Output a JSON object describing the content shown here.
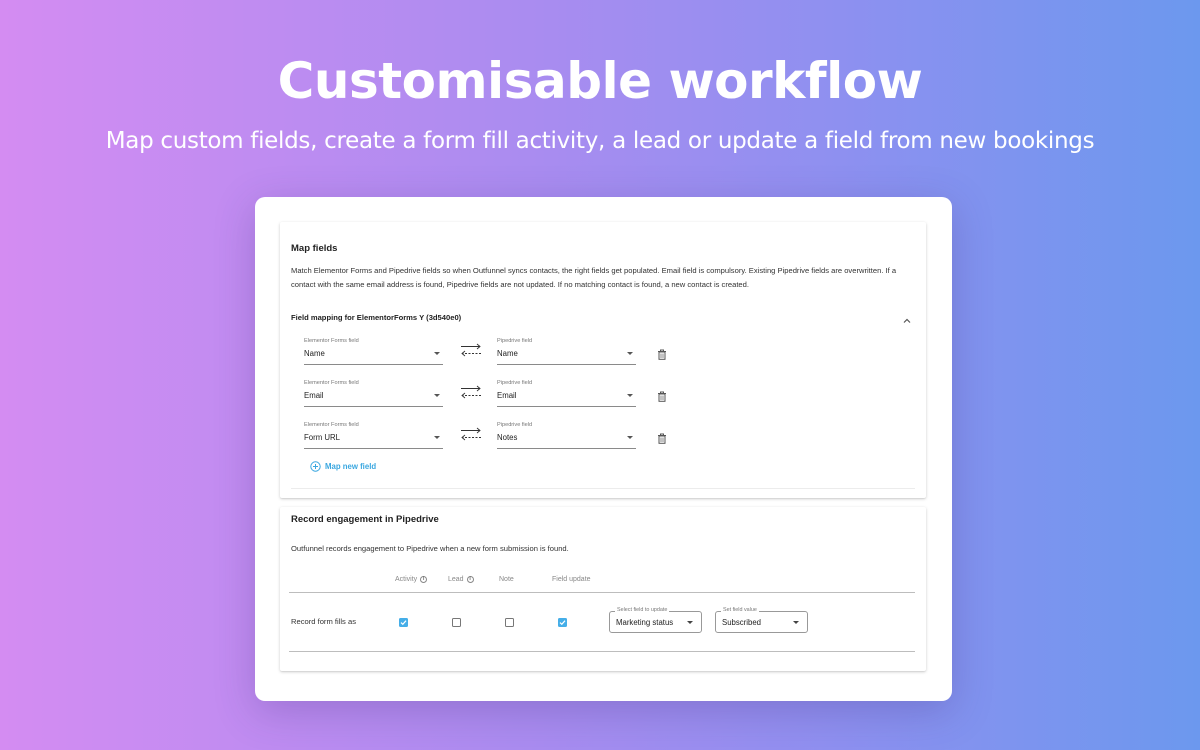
{
  "hero": {
    "title": "Customisable workflow",
    "subtitle": "Map custom fields, create a form fill activity, a lead or update a field from new bookings"
  },
  "map_fields": {
    "title": "Map fields",
    "description": "Match Elementor Forms and Pipedrive fields so when Outfunnel syncs contacts, the right fields get populated. Email field is compulsory. Existing Pipedrive fields are overwritten. If a contact with the same email address is found, Pipedrive fields are not updated. If no matching contact is found, a new contact is created.",
    "mapping_title": "Field mapping for ElementorForms Y (3d540e0)",
    "rows": [
      {
        "source_label": "Elementor Forms field",
        "source_value": "Name",
        "target_label": "Pipedrive field",
        "target_value": "Name"
      },
      {
        "source_label": "Elementor Forms field",
        "source_value": "Email",
        "target_label": "Pipedrive field",
        "target_value": "Email"
      },
      {
        "source_label": "Elementor Forms field",
        "source_value": "Form URL",
        "target_label": "Pipedrive field",
        "target_value": "Notes"
      }
    ],
    "add_label": "Map new field"
  },
  "record": {
    "title": "Record engagement in Pipedrive",
    "description": "Outfunnel records engagement to Pipedrive when a new form submission is found.",
    "columns": [
      "Activity",
      "Lead",
      "Note",
      "Field update"
    ],
    "row_label": "Record form fills as",
    "checks": {
      "activity": true,
      "lead": false,
      "note": false,
      "field_update": true
    },
    "field_select": {
      "label": "Select field to update",
      "value": "Marketing status"
    },
    "value_select": {
      "label": "Set field value",
      "value": "Subscribed"
    }
  },
  "colors": {
    "accent": "#45aee8",
    "link": "#3aa7e0"
  }
}
